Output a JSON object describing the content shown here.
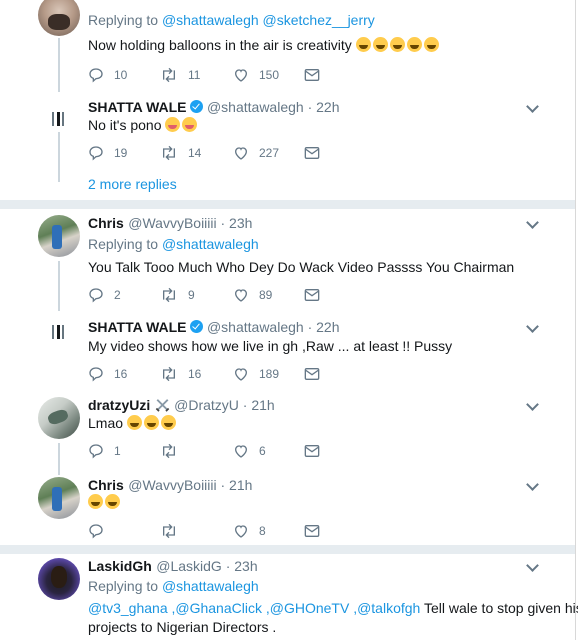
{
  "tweets": [
    {
      "reply_prefix": "Replying to ",
      "reply_to": "@shattawalegh @sketchez__jerry",
      "text": "Now holding balloons in the air is creativity",
      "emoji_count": 5,
      "replies": "10",
      "retweets": "11",
      "likes": "150"
    },
    {
      "name": "SHATTA WALE",
      "handle": "@shattawalegh · 22h",
      "text": "No it's pono",
      "replies": "19",
      "retweets": "14",
      "likes": "227"
    },
    {
      "more_replies": "2 more replies"
    },
    {
      "name": "Chris",
      "handle": "@WavvyBoiiiii · 23h",
      "reply_prefix": "Replying to ",
      "reply_to": "@shattawalegh",
      "text": "You Talk Tooo Much Who Dey Do Wack Video Passss You Chairman",
      "replies": "2",
      "retweets": "9",
      "likes": "89"
    },
    {
      "name": "SHATTA WALE",
      "handle": "@shattawalegh · 22h",
      "text": "My video shows how we live in gh ,Raw ... at least !! Pussy",
      "replies": "16",
      "retweets": "16",
      "likes": "189"
    },
    {
      "name": "dratzyUzi",
      "handle": "@DratzyU · 21h",
      "text": "Lmao",
      "replies": "1",
      "retweets": "",
      "likes": "6"
    },
    {
      "name": "Chris",
      "handle": "@WavvyBoiiiii · 21h",
      "text": "",
      "replies": "",
      "retweets": "",
      "likes": "8"
    },
    {
      "name": "LaskidGh",
      "handle": "@LaskidG · 23h",
      "reply_prefix": "Replying to ",
      "reply_to": "@shattawalegh",
      "mentions": "@tv3_ghana ,@GhanaClick ,@GHOneTV ,@talkofgh",
      "text_after": " Tell wale to stop given his",
      "text_line2": "projects to Nigerian Directors ."
    }
  ],
  "icons": [
    "reply-icon",
    "retweet-icon",
    "like-icon",
    "dm-icon",
    "chevron-down-icon",
    "verified-badge-icon",
    "crossed-swords-icon"
  ],
  "colors": {
    "link": "#1b95e0",
    "muted": "#657786",
    "verified": "#1da1f2",
    "separator": "#e6ecf0"
  }
}
